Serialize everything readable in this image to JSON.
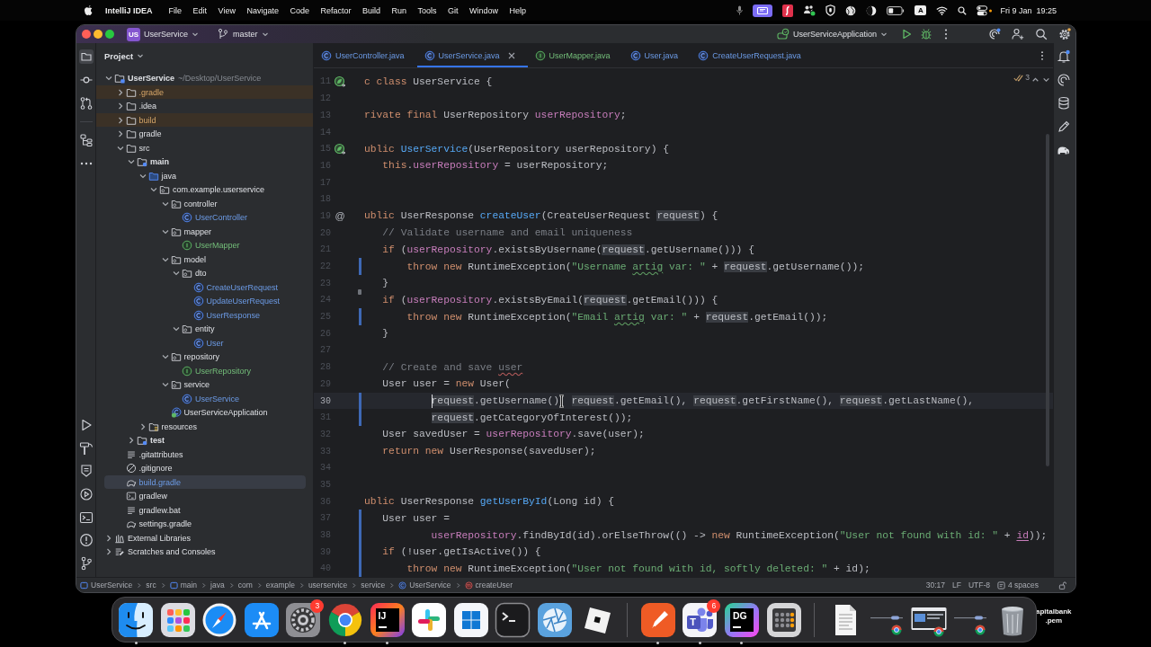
{
  "menu_bar": {
    "app_name": "IntelliJ IDEA",
    "items": [
      "File",
      "Edit",
      "View",
      "Navigate",
      "Code",
      "Refactor",
      "Build",
      "Run",
      "Tools",
      "Git",
      "Window",
      "Help"
    ],
    "input_source": "A",
    "date": "Fri 9 Jan",
    "time": "19:25"
  },
  "title_bar": {
    "project_badge": "US",
    "project": "UserService",
    "branch": "master",
    "run_config": "UserServiceApplication"
  },
  "project_panel": {
    "title": "Project",
    "tree": [
      {
        "name": "UserService",
        "path": "~/Desktop/UserService",
        "kind": "module",
        "expanded": true,
        "selected": false,
        "excluded": false,
        "children": [
          {
            "name": ".gradle",
            "kind": "folder",
            "expanded": false,
            "selected": false,
            "excluded": true
          },
          {
            "name": ".idea",
            "kind": "folder",
            "expanded": false,
            "selected": false,
            "excluded": false
          },
          {
            "name": "build",
            "kind": "folder",
            "expanded": false,
            "selected": false,
            "excluded": true
          },
          {
            "name": "gradle",
            "kind": "folder",
            "expanded": false,
            "selected": false,
            "excluded": false
          },
          {
            "name": "src",
            "kind": "folder",
            "expanded": true,
            "selected": false,
            "excluded": false,
            "children": [
              {
                "name": "main",
                "kind": "source-set",
                "expanded": true,
                "selected": false,
                "excluded": false,
                "children": [
                  {
                    "name": "java",
                    "kind": "source-root",
                    "expanded": true,
                    "selected": false,
                    "excluded": false,
                    "children": [
                      {
                        "name": "com.example.userservice",
                        "kind": "package",
                        "expanded": true,
                        "selected": false,
                        "excluded": false,
                        "children": [
                          {
                            "name": "controller",
                            "kind": "package",
                            "expanded": true,
                            "selected": false,
                            "excluded": false,
                            "children": [
                              {
                                "name": "UserController",
                                "kind": "class",
                                "vcs": {
                                  "kind": "modified"
                                },
                                "selected": false,
                                "excluded": false
                              }
                            ]
                          },
                          {
                            "name": "mapper",
                            "kind": "package",
                            "expanded": true,
                            "selected": false,
                            "excluded": false,
                            "children": [
                              {
                                "name": "UserMapper",
                                "kind": "interface",
                                "vcs": {
                                  "kind": "added"
                                },
                                "selected": false,
                                "excluded": false
                              }
                            ]
                          },
                          {
                            "name": "model",
                            "kind": "package",
                            "expanded": true,
                            "selected": false,
                            "excluded": false,
                            "children": [
                              {
                                "name": "dto",
                                "kind": "package",
                                "expanded": true,
                                "selected": false,
                                "excluded": false,
                                "children": [
                                  {
                                    "name": "CreateUserRequest",
                                    "kind": "class",
                                    "vcs": {
                                      "kind": "modified"
                                    },
                                    "selected": false,
                                    "excluded": false
                                  },
                                  {
                                    "name": "UpdateUserRequest",
                                    "kind": "class",
                                    "vcs": {
                                      "kind": "modified"
                                    },
                                    "selected": false,
                                    "excluded": false
                                  },
                                  {
                                    "name": "UserResponse",
                                    "kind": "class",
                                    "vcs": {
                                      "kind": "modified"
                                    },
                                    "selected": false,
                                    "excluded": false
                                  }
                                ]
                              },
                              {
                                "name": "entity",
                                "kind": "package",
                                "expanded": true,
                                "selected": false,
                                "excluded": false,
                                "children": [
                                  {
                                    "name": "User",
                                    "kind": "class",
                                    "vcs": {
                                      "kind": "modified"
                                    },
                                    "selected": false,
                                    "excluded": false
                                  }
                                ]
                              }
                            ]
                          },
                          {
                            "name": "repository",
                            "kind": "package",
                            "expanded": true,
                            "selected": false,
                            "excluded": false,
                            "children": [
                              {
                                "name": "UserRepository",
                                "kind": "interface",
                                "vcs": {
                                  "kind": "added"
                                },
                                "selected": false,
                                "excluded": false
                              }
                            ]
                          },
                          {
                            "name": "service",
                            "kind": "package",
                            "expanded": true,
                            "selected": false,
                            "excluded": false,
                            "children": [
                              {
                                "name": "UserService",
                                "kind": "class",
                                "vcs": {
                                  "kind": "modified"
                                },
                                "selected": false,
                                "excluded": false
                              }
                            ]
                          },
                          {
                            "name": "UserServiceApplication",
                            "kind": "app-class",
                            "selected": false,
                            "excluded": false
                          }
                        ]
                      }
                    ]
                  },
                  {
                    "name": "resources",
                    "kind": "resources-root",
                    "expanded": false,
                    "selected": false,
                    "excluded": false
                  }
                ]
              },
              {
                "name": "test",
                "kind": "source-set",
                "expanded": false,
                "selected": false,
                "excluded": false
              }
            ]
          },
          {
            "name": ".gitattributes",
            "kind": "text-file",
            "selected": false,
            "excluded": false
          },
          {
            "name": ".gitignore",
            "kind": "ignore-file",
            "selected": false,
            "excluded": false
          },
          {
            "name": "build.gradle",
            "kind": "gradle-file",
            "vcs": {
              "kind": "modified"
            },
            "selected": true,
            "excluded": false
          },
          {
            "name": "gradlew",
            "kind": "script-file",
            "selected": false,
            "excluded": false
          },
          {
            "name": "gradlew.bat",
            "kind": "text-file",
            "selected": false,
            "excluded": false
          },
          {
            "name": "settings.gradle",
            "kind": "gradle-file",
            "selected": false,
            "excluded": false
          }
        ]
      },
      {
        "name": "External Libraries",
        "kind": "libraries",
        "expanded": false,
        "selected": false,
        "excluded": false
      },
      {
        "name": "Scratches and Consoles",
        "kind": "scratches",
        "expanded": false,
        "selected": false,
        "excluded": false
      }
    ]
  },
  "editor_tabs": [
    {
      "label": "UserController.java",
      "kind": "class",
      "vcs": {
        "kind": "modified"
      },
      "selected": false
    },
    {
      "label": "UserService.java",
      "kind": "class",
      "vcs": {
        "kind": "modified"
      },
      "selected": true
    },
    {
      "label": "UserMapper.java",
      "kind": "interface",
      "vcs": {
        "kind": "added"
      },
      "selected": false
    },
    {
      "label": "User.java",
      "kind": "class",
      "vcs": {
        "kind": "modified"
      },
      "selected": false
    },
    {
      "label": "CreateUserRequest.java",
      "kind": "class",
      "vcs": {
        "kind": "modified"
      },
      "selected": false
    }
  ],
  "editor": {
    "inspection_count": "3",
    "lines": [
      {
        "number": "11",
        "gutter": {
          "kind": "bean"
        },
        "current": false,
        "tokens": [
          {
            "kind": "keyword",
            "text": "c class"
          },
          {
            "kind": "plain",
            "text": " UserService {"
          }
        ]
      },
      {
        "number": "12",
        "current": false
      },
      {
        "number": "13",
        "current": false,
        "tokens": [
          {
            "kind": "keyword",
            "text": "rivate final"
          },
          {
            "kind": "plain",
            "text": " UserRepository "
          },
          {
            "kind": "field",
            "text": "userRepository"
          },
          {
            "kind": "plain",
            "text": ";"
          }
        ]
      },
      {
        "number": "14",
        "current": false
      },
      {
        "number": "15",
        "gutter": {
          "kind": "bean"
        },
        "current": false,
        "tokens": [
          {
            "kind": "keyword",
            "text": "ublic"
          },
          {
            "kind": "method",
            "text": " UserService"
          },
          {
            "kind": "plain",
            "text": "(UserRepository userRepository) {"
          }
        ]
      },
      {
        "number": "16",
        "current": false,
        "tokens": [
          {
            "kind": "keyword",
            "text": "   this"
          },
          {
            "kind": "plain",
            "text": "."
          },
          {
            "kind": "field",
            "text": "userRepository"
          },
          {
            "kind": "plain",
            "text": " = userRepository;"
          }
        ]
      },
      {
        "number": "17",
        "current": false
      },
      {
        "number": "18",
        "current": false
      },
      {
        "number": "19",
        "gutter_text": "@",
        "current": false,
        "tokens": [
          {
            "kind": "keyword",
            "text": "ublic"
          },
          {
            "kind": "plain",
            "text": " UserResponse "
          },
          {
            "kind": "method",
            "text": "createUser"
          },
          {
            "kind": "plain",
            "text": "(CreateUserRequest "
          },
          {
            "kind": "usage",
            "text": "request"
          },
          {
            "kind": "plain",
            "text": ") {"
          }
        ]
      },
      {
        "number": "20",
        "current": false,
        "tokens": [
          {
            "kind": "comment",
            "text": "   // Validate username and email uniqueness"
          }
        ]
      },
      {
        "number": "21",
        "current": false,
        "tokens": [
          {
            "kind": "keyword",
            "text": "   if"
          },
          {
            "kind": "plain",
            "text": " ("
          },
          {
            "kind": "field",
            "text": "userRepository"
          },
          {
            "kind": "plain",
            "text": ".existsByUsername("
          },
          {
            "kind": "usage",
            "text": "request"
          },
          {
            "kind": "plain",
            "text": ".getUsername())) {"
          }
        ]
      },
      {
        "number": "22",
        "change": {
          "kind": "modified"
        },
        "current": false,
        "tokens": [
          {
            "kind": "keyword",
            "text": "       throw new"
          },
          {
            "kind": "plain",
            "text": " RuntimeException("
          },
          {
            "kind": "string",
            "text": "\"Username "
          },
          {
            "kind": "string_typo",
            "text": "artig"
          },
          {
            "kind": "string",
            "text": " var: \""
          },
          {
            "kind": "plain",
            "text": " + "
          },
          {
            "kind": "usage",
            "text": "request"
          },
          {
            "kind": "plain",
            "text": ".getUsername());"
          }
        ]
      },
      {
        "number": "23",
        "change": {
          "kind": "deleted"
        },
        "current": false,
        "tokens": [
          {
            "kind": "plain",
            "text": "   }"
          }
        ]
      },
      {
        "number": "24",
        "current": false,
        "tokens": [
          {
            "kind": "keyword",
            "text": "   if"
          },
          {
            "kind": "plain",
            "text": " ("
          },
          {
            "kind": "field",
            "text": "userRepository"
          },
          {
            "kind": "plain",
            "text": ".existsByEmail("
          },
          {
            "kind": "usage",
            "text": "request"
          },
          {
            "kind": "plain",
            "text": ".getEmail())) {"
          }
        ]
      },
      {
        "number": "25",
        "change": {
          "kind": "modified"
        },
        "current": false,
        "tokens": [
          {
            "kind": "keyword",
            "text": "       throw new"
          },
          {
            "kind": "plain",
            "text": " RuntimeException("
          },
          {
            "kind": "string",
            "text": "\"Email "
          },
          {
            "kind": "string_typo",
            "text": "artig"
          },
          {
            "kind": "string",
            "text": " var: \""
          },
          {
            "kind": "plain",
            "text": " + "
          },
          {
            "kind": "usage",
            "text": "request"
          },
          {
            "kind": "plain",
            "text": ".getEmail());"
          }
        ]
      },
      {
        "number": "26",
        "current": false,
        "tokens": [
          {
            "kind": "plain",
            "text": "   }"
          }
        ]
      },
      {
        "number": "27",
        "current": false
      },
      {
        "number": "28",
        "current": false,
        "tokens": [
          {
            "kind": "comment",
            "text": "   // Create and save "
          },
          {
            "kind": "comment_typo",
            "text": "user"
          }
        ]
      },
      {
        "number": "29",
        "current": false,
        "tokens": [
          {
            "kind": "plain",
            "text": "   User user = "
          },
          {
            "kind": "keyword",
            "text": "new"
          },
          {
            "kind": "plain",
            "text": " User("
          }
        ]
      },
      {
        "number": "30",
        "change": {
          "kind": "modified"
        },
        "current": true,
        "tokens": [
          {
            "kind": "caret"
          },
          {
            "kind": "usage",
            "text": "           request"
          },
          {
            "kind": "plain",
            "text": ".getUsername()"
          },
          {
            "kind": "pointer"
          },
          {
            "kind": "usage",
            "text": " request"
          },
          {
            "kind": "plain",
            "text": ".getEmail(), "
          },
          {
            "kind": "usage",
            "text": "request"
          },
          {
            "kind": "plain",
            "text": ".getFirstName(), "
          },
          {
            "kind": "usage",
            "text": "request"
          },
          {
            "kind": "plain",
            "text": ".getLastName(),"
          }
        ]
      },
      {
        "number": "31",
        "change": {
          "kind": "modified"
        },
        "current": false,
        "tokens": [
          {
            "kind": "usage",
            "text": "           request"
          },
          {
            "kind": "plain",
            "text": ".getCategoryOfInterest());"
          }
        ]
      },
      {
        "number": "32",
        "current": false,
        "tokens": [
          {
            "kind": "plain",
            "text": "   User savedUser = "
          },
          {
            "kind": "field",
            "text": "userRepository"
          },
          {
            "kind": "plain",
            "text": ".save(user);"
          }
        ]
      },
      {
        "number": "33",
        "current": false,
        "tokens": [
          {
            "kind": "keyword",
            "text": "   return new"
          },
          {
            "kind": "plain",
            "text": " UserResponse(savedUser);"
          }
        ]
      },
      {
        "number": "34",
        "current": false
      },
      {
        "number": "35",
        "current": false
      },
      {
        "number": "36",
        "current": false,
        "tokens": [
          {
            "kind": "keyword",
            "text": "ublic"
          },
          {
            "kind": "plain",
            "text": " UserResponse "
          },
          {
            "kind": "method",
            "text": "getUserById"
          },
          {
            "kind": "plain",
            "text": "(Long id) {"
          }
        ]
      },
      {
        "number": "37",
        "change": {
          "kind": "modified"
        },
        "current": false,
        "tokens": [
          {
            "kind": "plain",
            "text": "   User user ="
          }
        ]
      },
      {
        "number": "38",
        "change": {
          "kind": "modified"
        },
        "current": false,
        "tokens": [
          {
            "kind": "field",
            "text": "           userRepository"
          },
          {
            "kind": "plain",
            "text": ".findById(id).orElseThrow(() -> "
          },
          {
            "kind": "keyword",
            "text": "new"
          },
          {
            "kind": "plain",
            "text": " RuntimeException("
          },
          {
            "kind": "string",
            "text": "\"User not found with id: \""
          },
          {
            "kind": "plain",
            "text": " + "
          },
          {
            "kind": "captured",
            "text": "id"
          },
          {
            "kind": "plain",
            "text": "));"
          }
        ]
      },
      {
        "number": "39",
        "change": {
          "kind": "modified"
        },
        "current": false,
        "tokens": [
          {
            "kind": "keyword",
            "text": "   if"
          },
          {
            "kind": "plain",
            "text": " (!user.getIsActive()) {"
          }
        ]
      },
      {
        "number": "40",
        "change": {
          "kind": "modified"
        },
        "current": false,
        "tokens": [
          {
            "kind": "keyword",
            "text": "       throw new"
          },
          {
            "kind": "plain",
            "text": " RuntimeException("
          },
          {
            "kind": "string",
            "text": "\"User not found with id, softly deleted: \""
          },
          {
            "kind": "plain",
            "text": " + id);"
          }
        ]
      }
    ]
  },
  "status_bar": {
    "breadcrumbs": [
      {
        "label": "UserService",
        "kind": "module"
      },
      {
        "label": "src"
      },
      {
        "label": "main",
        "kind": "module"
      },
      {
        "label": "java"
      },
      {
        "label": "com"
      },
      {
        "label": "example"
      },
      {
        "label": "userservice"
      },
      {
        "label": "service"
      },
      {
        "label": "UserService",
        "kind": "class"
      },
      {
        "label": "createUser",
        "kind": "method"
      }
    ],
    "caret_position": "30:17",
    "line_separator": "LF",
    "encoding": "UTF-8",
    "indent": "4 spaces"
  },
  "dock": {
    "apps": [
      {
        "kind": "finder",
        "running": true
      },
      {
        "kind": "launchpad",
        "running": false
      },
      {
        "kind": "safari",
        "running": false
      },
      {
        "kind": "appstore",
        "running": false
      },
      {
        "kind": "settings",
        "running": false,
        "badge": "3"
      },
      {
        "kind": "chrome",
        "running": true
      },
      {
        "kind": "intellij",
        "label": "IJ",
        "running": true
      },
      {
        "kind": "slack",
        "running": false
      },
      {
        "kind": "windows",
        "running": false
      },
      {
        "kind": "terminal",
        "running": false
      },
      {
        "kind": "aperture",
        "running": false
      },
      {
        "kind": "cube",
        "running": false
      },
      {
        "kind": "separator"
      },
      {
        "kind": "postman",
        "running": true
      },
      {
        "kind": "teams",
        "label": "T",
        "running": true,
        "badge": "6"
      },
      {
        "kind": "datagrip",
        "label": "DG",
        "running": true
      },
      {
        "kind": "calculator",
        "running": false
      },
      {
        "kind": "separator"
      },
      {
        "kind": "document",
        "running": false
      },
      {
        "kind": "window_line",
        "running": false
      },
      {
        "kind": "window_thumb",
        "running": false
      },
      {
        "kind": "window_line",
        "running": false
      },
      {
        "kind": "trash",
        "running": false
      }
    ]
  },
  "desktop_file": {
    "label_lines": [
      "apitalbank",
      ".pem"
    ]
  }
}
